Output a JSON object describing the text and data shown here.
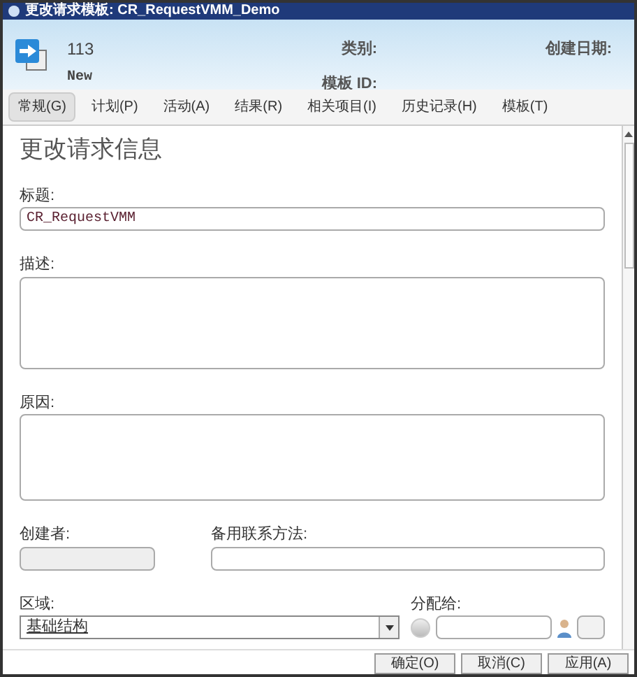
{
  "window": {
    "title": "更改请求模板: CR_RequestVMM_Demo"
  },
  "header": {
    "id": "113",
    "status": "New",
    "category_label": "类别:",
    "template_id_label": "模板 ID:",
    "created_label": "创建日期:"
  },
  "tabs": [
    {
      "label": "常规(G)",
      "selected": true
    },
    {
      "label": "计划(P)",
      "selected": false
    },
    {
      "label": "活动(A)",
      "selected": false
    },
    {
      "label": "结果(R)",
      "selected": false
    },
    {
      "label": "相关项目(I)",
      "selected": false
    },
    {
      "label": "历史记录(H)",
      "selected": false
    },
    {
      "label": "模板(T)",
      "selected": false
    }
  ],
  "section_title": "更改请求信息",
  "form": {
    "title_label": "标题:",
    "title_value": "CR_RequestVMM",
    "description_label": "描述:",
    "reason_label": "原因:",
    "creator_label": "创建者:",
    "creator_disabled": true,
    "alt_contact_label": "备用联系方法:",
    "area_label": "区域:",
    "area_value": "基础结构",
    "assign_label": "分配给:"
  },
  "buttons": [
    "确定(O)",
    "取消(C)",
    "应用(A)"
  ]
}
